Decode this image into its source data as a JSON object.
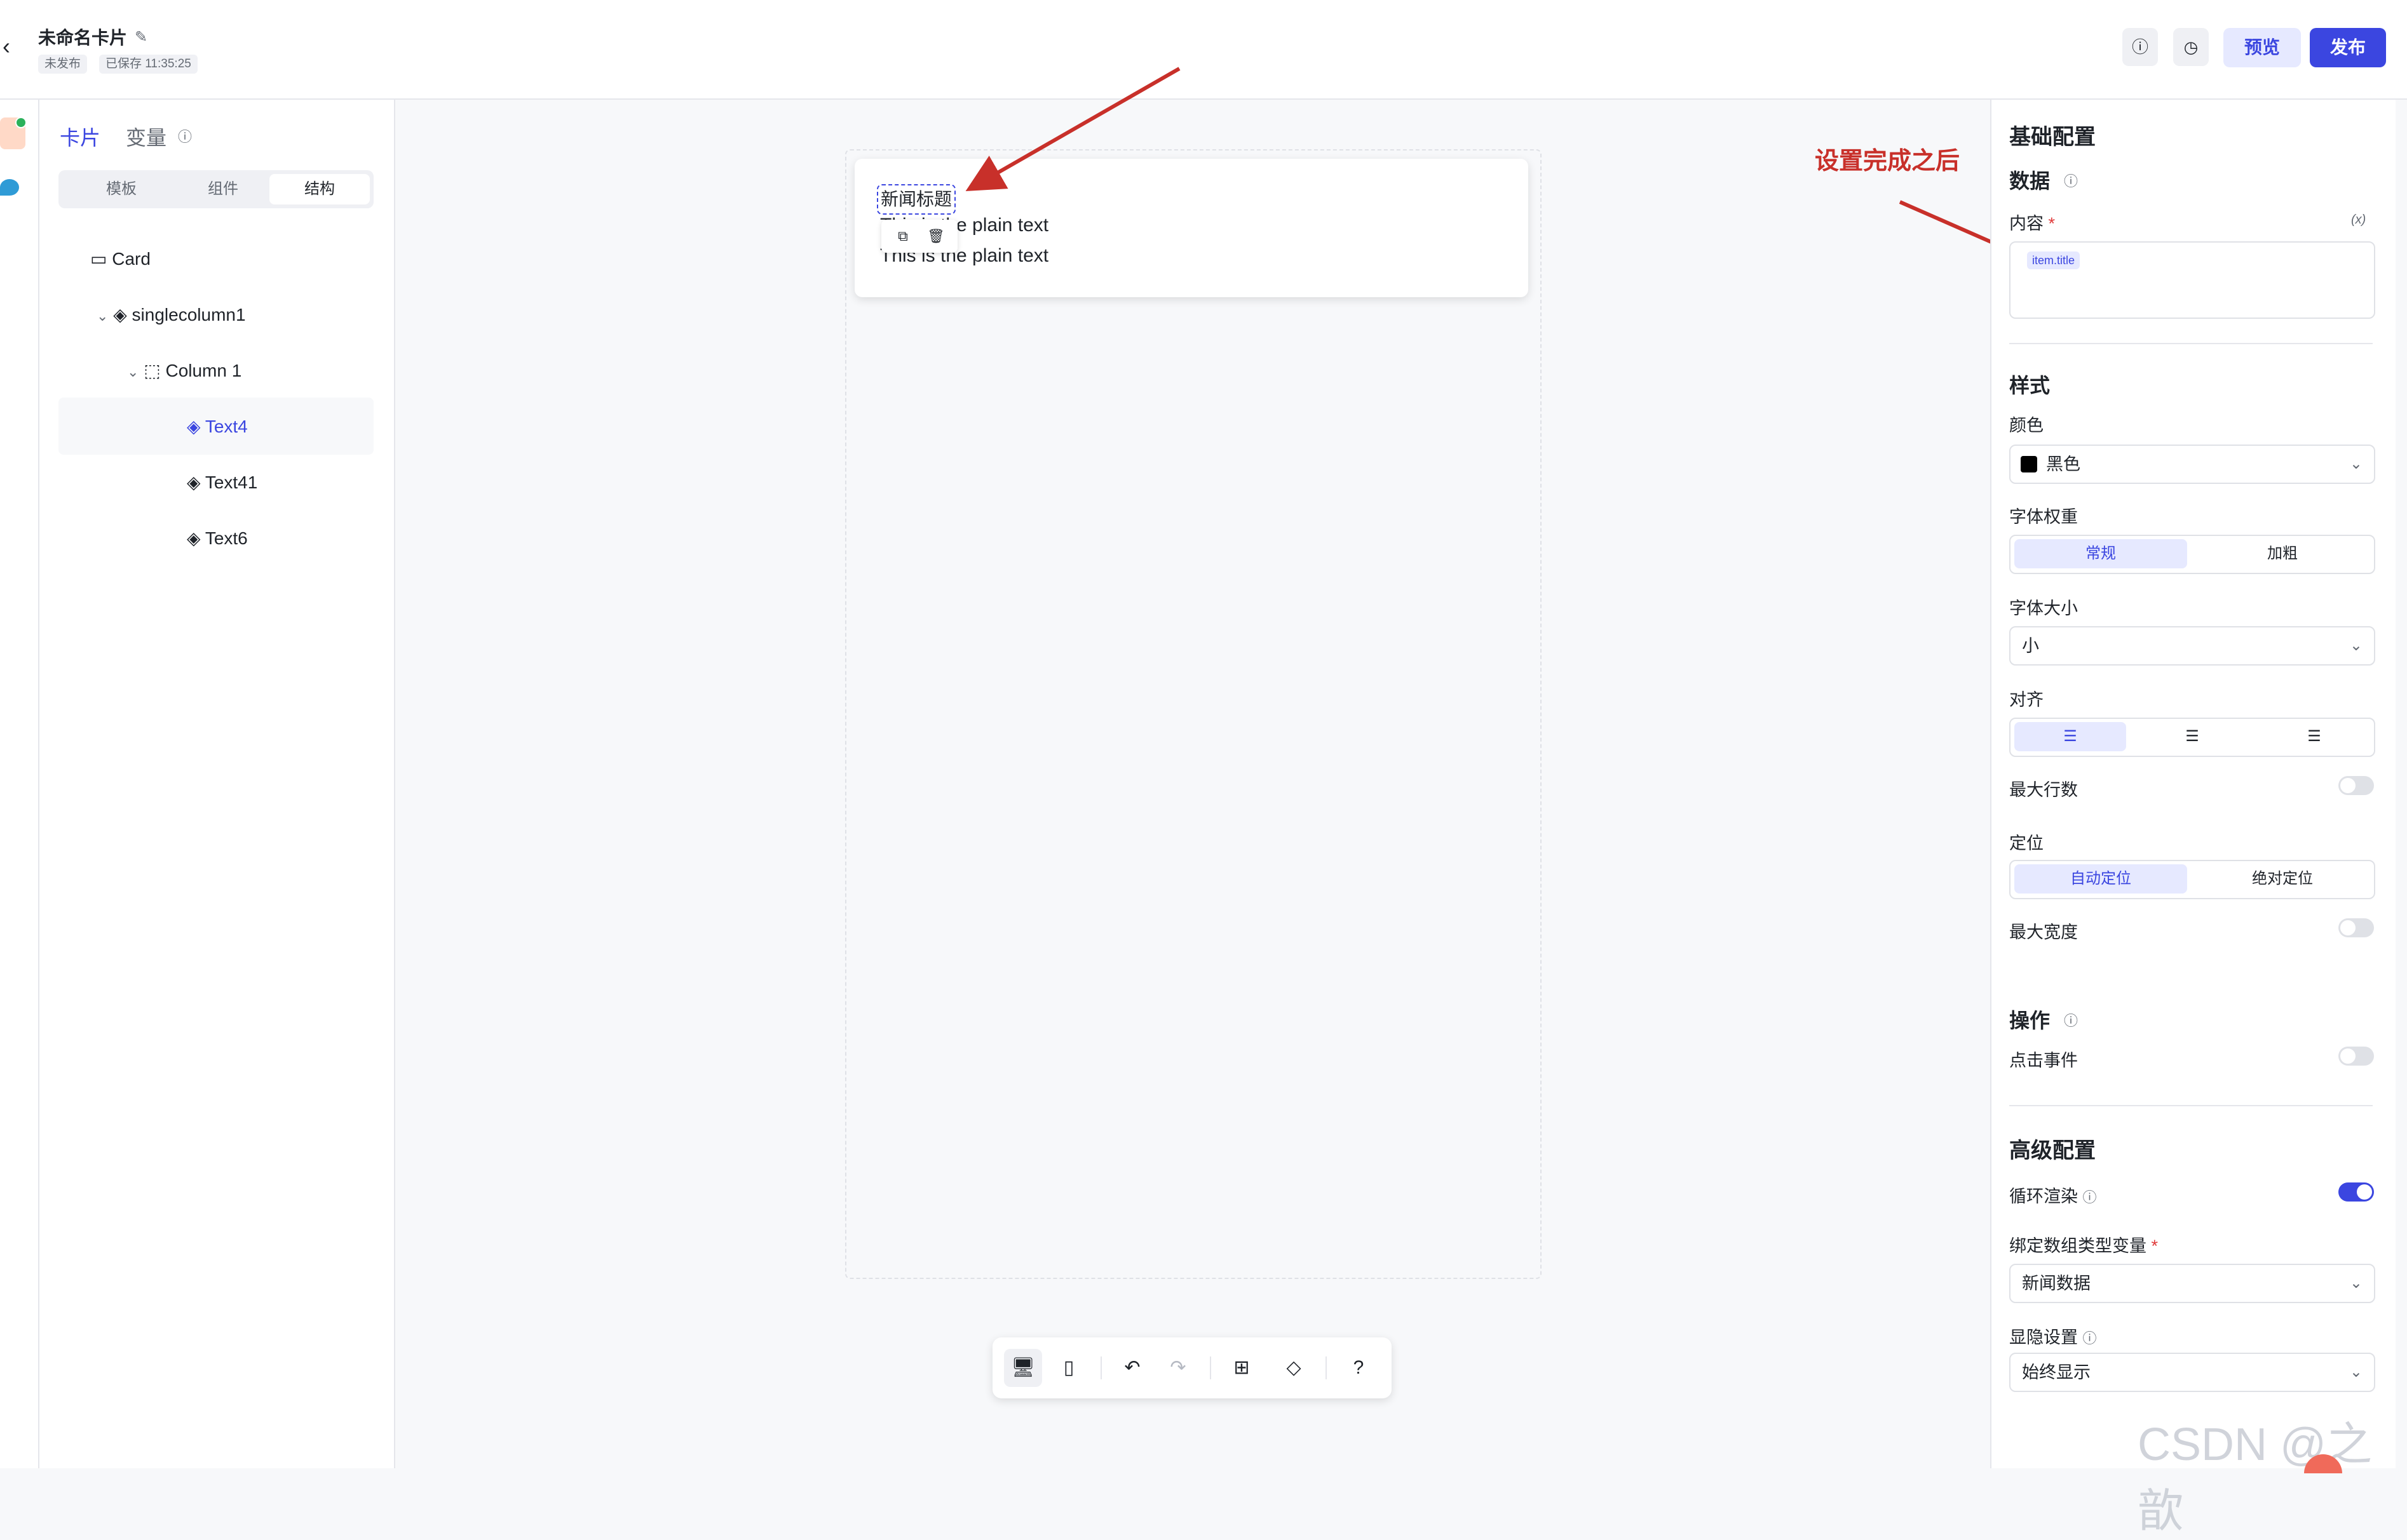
{
  "header": {
    "back_icon": "chevron-left-icon",
    "title": "未命名卡片",
    "edit_icon": "edit-icon",
    "status_unpublished": "未发布",
    "saved_time": "已保存 11:35:25",
    "info_icon": "info-icon",
    "history_icon": "clock-icon",
    "preview_label": "预览",
    "publish_label": "发布"
  },
  "left_panel": {
    "tabs": [
      {
        "label": "卡片",
        "active": true
      },
      {
        "label": "变量",
        "active": false
      }
    ],
    "segments": [
      {
        "label": "模板"
      },
      {
        "label": "组件"
      },
      {
        "label": "结构",
        "active": true
      }
    ],
    "tree": [
      {
        "label": "Card",
        "icon": "card-icon",
        "level": 0
      },
      {
        "label": "singlecolumn1",
        "icon": "layers-icon",
        "level": 1,
        "expanded": true
      },
      {
        "label": "Column 1",
        "icon": "column-icon",
        "level": 2,
        "expanded": true
      },
      {
        "label": "Text4",
        "icon": "layers-icon",
        "level": 3,
        "selected": true
      },
      {
        "label": "Text41",
        "icon": "layers-icon",
        "level": 3
      },
      {
        "label": "Text6",
        "icon": "layers-icon",
        "level": 3
      }
    ]
  },
  "canvas": {
    "news_title": "新闻标题",
    "plain_text_1": "This is the plain text",
    "plain_text_2": "This is the plain text",
    "annotation": "设置完成之后"
  },
  "toolbar": {
    "icons": [
      "desktop-icon",
      "mobile-icon",
      "undo-icon",
      "redo-icon",
      "grid-icon",
      "eraser-icon",
      "help-icon"
    ]
  },
  "right_panel": {
    "basic_config": "基础配置",
    "data_title": "数据",
    "content_label": "内容",
    "required_mark": "*",
    "fx_label": "(x)",
    "content_tag": "item.title",
    "style_title": "样式",
    "color_label": "颜色",
    "color_value": "黑色",
    "font_weight_label": "字体权重",
    "font_weight_options": [
      "常规",
      "加粗"
    ],
    "font_size_label": "字体大小",
    "font_size_value": "小",
    "align_label": "对齐",
    "max_lines_label": "最大行数",
    "position_label": "定位",
    "position_options": [
      "自动定位",
      "绝对定位"
    ],
    "max_width_label": "最大宽度",
    "action_title": "操作",
    "click_event_label": "点击事件",
    "advanced_title": "高级配置",
    "loop_render_label": "循环渲染",
    "bind_array_label": "绑定数组类型变量",
    "bind_array_value": "新闻数据",
    "visibility_label": "显隐设置",
    "visibility_value": "始终显示"
  },
  "watermark": "CSDN @之歆",
  "colors": {
    "accent": "#3b46e0",
    "annotation": "#c8302a"
  }
}
